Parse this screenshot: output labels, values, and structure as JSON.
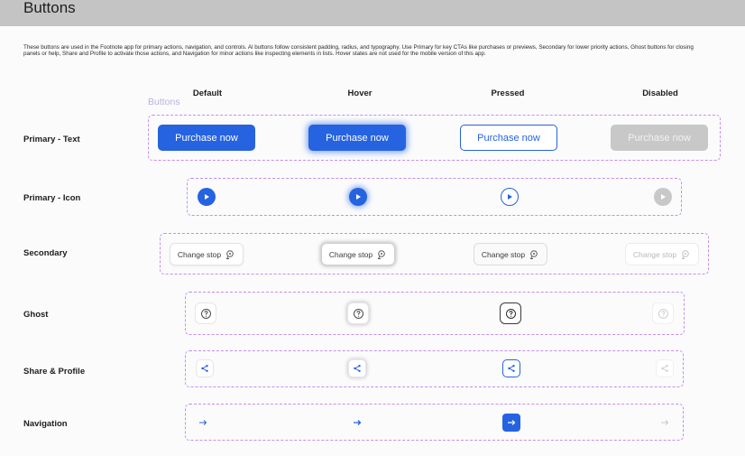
{
  "header": {
    "title": "Buttons"
  },
  "description": "These buttons are used in the Footnote app for primary actions, navigation, and controls. Al buttons follow consistent padding, radius, and typography. Use Primary for key CTAs like purchases or previews, Secondary for lower priority actions, Ghost buttons for closing panels or help, Share and Profile to activate those actions, and Navigation for minor actions like inspecting elements in lists. Hover states are not used for the mobile version of this app.",
  "columns": [
    "Default",
    "Hover",
    "Pressed",
    "Disabled"
  ],
  "buttons_caption": "Buttons",
  "rows": [
    {
      "label": "Primary - Text",
      "button_label": "Purchase now"
    },
    {
      "label": "Primary - Icon",
      "icon": "play-icon"
    },
    {
      "label": "Secondary",
      "button_label": "Change stop",
      "icon": "route-stop-icon"
    },
    {
      "label": "Ghost",
      "icon": "help-circle-icon"
    },
    {
      "label": "Share & Profile",
      "icon": "share-icon"
    },
    {
      "label": "Navigation",
      "icon": "arrow-right-icon"
    }
  ],
  "colors": {
    "primary": "#2563e0",
    "disabled": "#c8c8c8",
    "frame": "#c38ff0",
    "header_bg": "#c4c4c4"
  }
}
